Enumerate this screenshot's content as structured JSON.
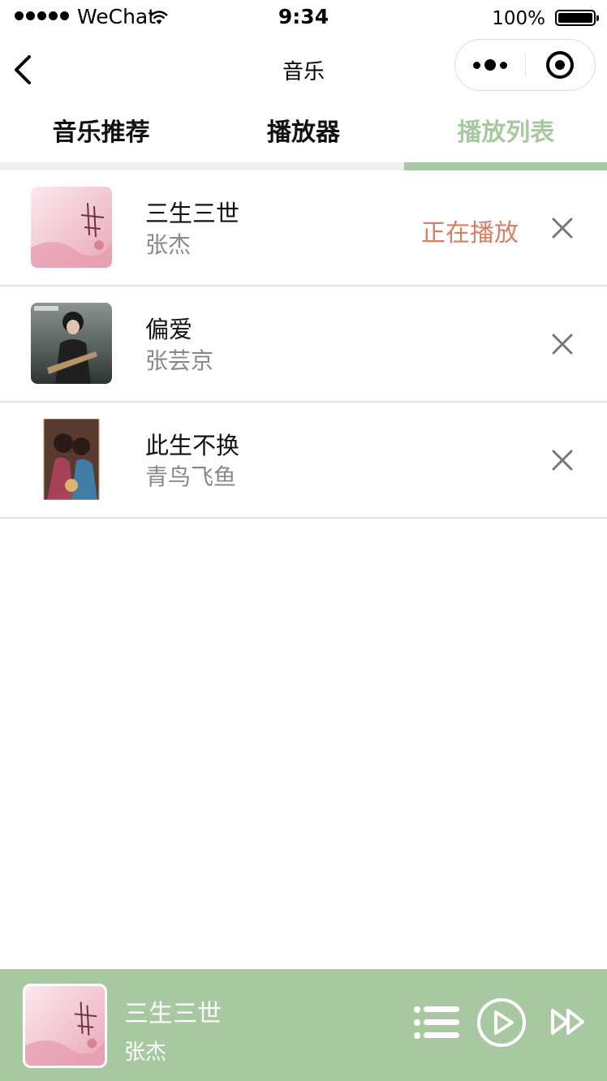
{
  "status_bar": {
    "carrier": "WeChat",
    "time": "9:34",
    "battery": "100%"
  },
  "nav": {
    "title": "音乐"
  },
  "tabs": [
    {
      "label": "音乐推荐",
      "active": false
    },
    {
      "label": "播放器",
      "active": false
    },
    {
      "label": "播放列表",
      "active": true
    }
  ],
  "playlist": [
    {
      "title": "三生三世",
      "artist": "张杰",
      "status": "正在播放"
    },
    {
      "title": "偏爱",
      "artist": "张芸京",
      "status": ""
    },
    {
      "title": "此生不换",
      "artist": "青鸟飞鱼",
      "status": ""
    }
  ],
  "player": {
    "title": "三生三世",
    "artist": "张杰"
  },
  "colors": {
    "accent": "#a8c8a2",
    "now_playing": "#d57f67",
    "muted_text": "#888888"
  },
  "icons": {
    "back": "chevron-left-icon",
    "more": "more-dots-icon",
    "close": "target-close-icon",
    "remove": "close-x-icon",
    "list": "playlist-icon",
    "play": "play-circle-icon",
    "next": "next-icon"
  }
}
